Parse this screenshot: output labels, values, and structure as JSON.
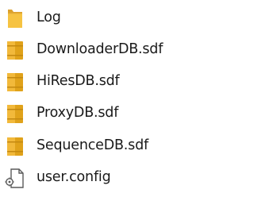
{
  "files": [
    {
      "name": "Log",
      "icon": "folder-icon"
    },
    {
      "name": "DownloaderDB.sdf",
      "icon": "database-file-icon"
    },
    {
      "name": "HiResDB.sdf",
      "icon": "database-file-icon"
    },
    {
      "name": "ProxyDB.sdf",
      "icon": "database-file-icon"
    },
    {
      "name": "SequenceDB.sdf",
      "icon": "database-file-icon"
    },
    {
      "name": "user.config",
      "icon": "config-file-icon"
    }
  ],
  "colors": {
    "folder": "#f6c342",
    "database": "#e0a21a",
    "text": "#1a1a1a"
  }
}
